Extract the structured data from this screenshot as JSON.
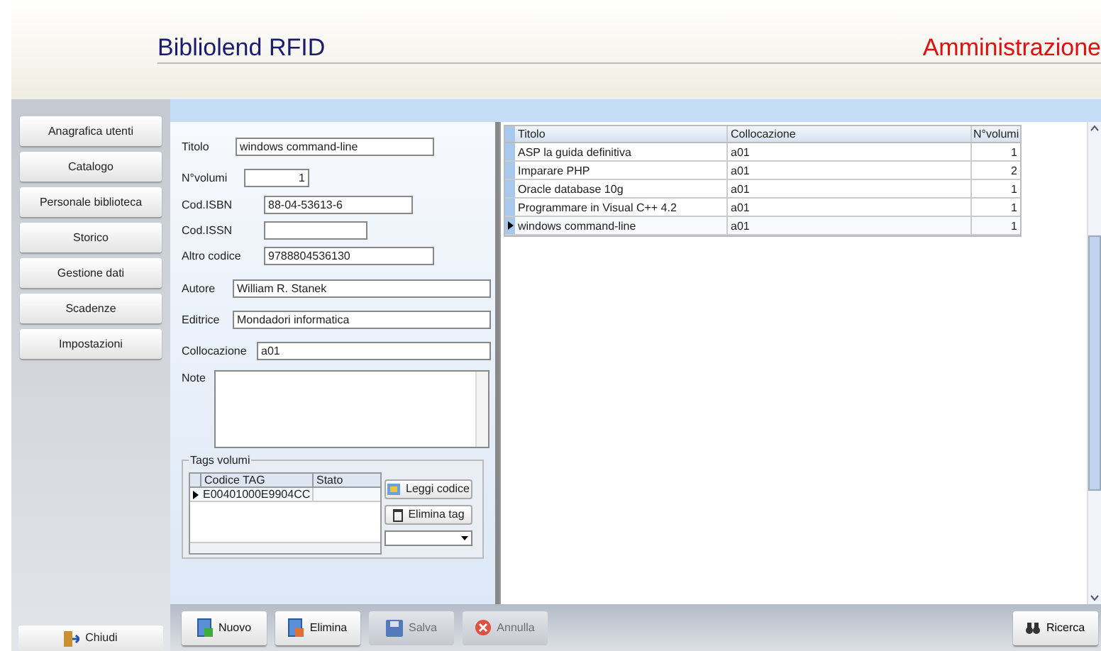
{
  "header": {
    "title": "Bibliolend RFID",
    "section": "Amministrazione"
  },
  "sidebar": {
    "items": [
      {
        "label": "Anagrafica utenti"
      },
      {
        "label": "Catalogo"
      },
      {
        "label": "Personale biblioteca"
      },
      {
        "label": "Storico"
      },
      {
        "label": "Gestione dati"
      },
      {
        "label": "Scadenze"
      },
      {
        "label": "Impostazioni"
      }
    ],
    "exit": "Chiudi"
  },
  "form": {
    "fields": [
      {
        "label": "Titolo",
        "value": "windows command-line"
      },
      {
        "label": "N°volumi",
        "value": "1"
      },
      {
        "label": "Cod.ISBN",
        "value": "88-04-53613-6"
      },
      {
        "label": "Cod.ISSN"
      },
      {
        "label": "Altro codice",
        "value": "9788804536130"
      },
      {
        "label": "Autore",
        "value": "William R. Stanek"
      },
      {
        "label": "Editrice",
        "value": "Mondadori informatica"
      },
      {
        "label": "Collocazione",
        "value": "a01"
      }
    ],
    "note": {
      "label": "Note"
    },
    "tags": {
      "title": "Tags volumi",
      "columns": [
        "Codice TAG",
        "Stato"
      ],
      "rows": [
        {
          "cells": [
            "E00401000E9904CC",
            ""
          ],
          "selected": true
        }
      ],
      "buttons": [
        "Leggi codice",
        "Elimina tag"
      ]
    }
  },
  "table": {
    "columns": [
      "Titolo",
      "Collocazione",
      "N°volumi"
    ],
    "rows": [
      {
        "cells": [
          "ASP la guida definitiva",
          "a01",
          "1"
        ],
        "selected": false
      },
      {
        "cells": [
          "Imparare PHP",
          "a01",
          "2"
        ],
        "selected": false
      },
      {
        "cells": [
          "Oracle database 10g",
          "a01",
          "1"
        ],
        "selected": false
      },
      {
        "cells": [
          "Programmare in Visual C++ 4.2",
          "a01",
          "1"
        ],
        "selected": false
      },
      {
        "cells": [
          "windows command-line",
          "a01",
          "1"
        ],
        "selected": true
      }
    ]
  },
  "toolbar": {
    "buttons": [
      {
        "label": "Nuovo",
        "kind": "new",
        "disabled": false
      },
      {
        "label": "Elimina",
        "kind": "delete",
        "disabled": false
      },
      {
        "label": "Salva",
        "kind": "save",
        "disabled": true
      },
      {
        "label": "Annulla",
        "kind": "cancel",
        "disabled": true
      }
    ],
    "search": "Ricerca"
  }
}
